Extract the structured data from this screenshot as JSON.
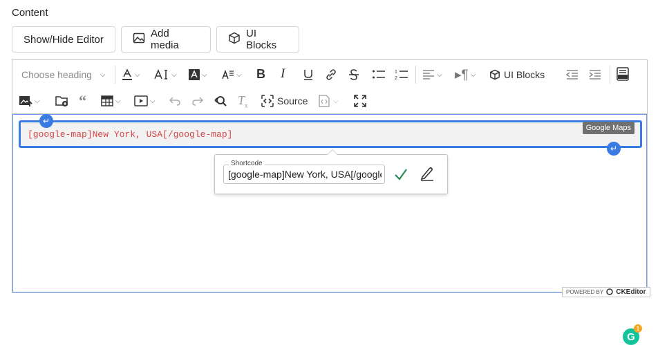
{
  "section": {
    "label": "Content"
  },
  "buttons": {
    "show_hide": "Show/Hide Editor",
    "add_media": "Add media",
    "ui_blocks": "UI Blocks"
  },
  "toolbar": {
    "heading_placeholder": "Choose heading",
    "ui_blocks": "UI Blocks",
    "source": "Source"
  },
  "content": {
    "shortcode": "[google-map]New York, USA[/google-map]",
    "widget_label": "Google Maps"
  },
  "balloon": {
    "field_label": "Shortcode",
    "field_value": "[google-map]New York, USA[/google-r"
  },
  "grammarly": {
    "count": "1"
  },
  "footer": {
    "powered_by": "POWERED BY",
    "brand": "CKEditor"
  },
  "colors": {
    "accent": "#3a7be3",
    "shortcode_text": "#d64545",
    "check": "#2e8b57"
  }
}
